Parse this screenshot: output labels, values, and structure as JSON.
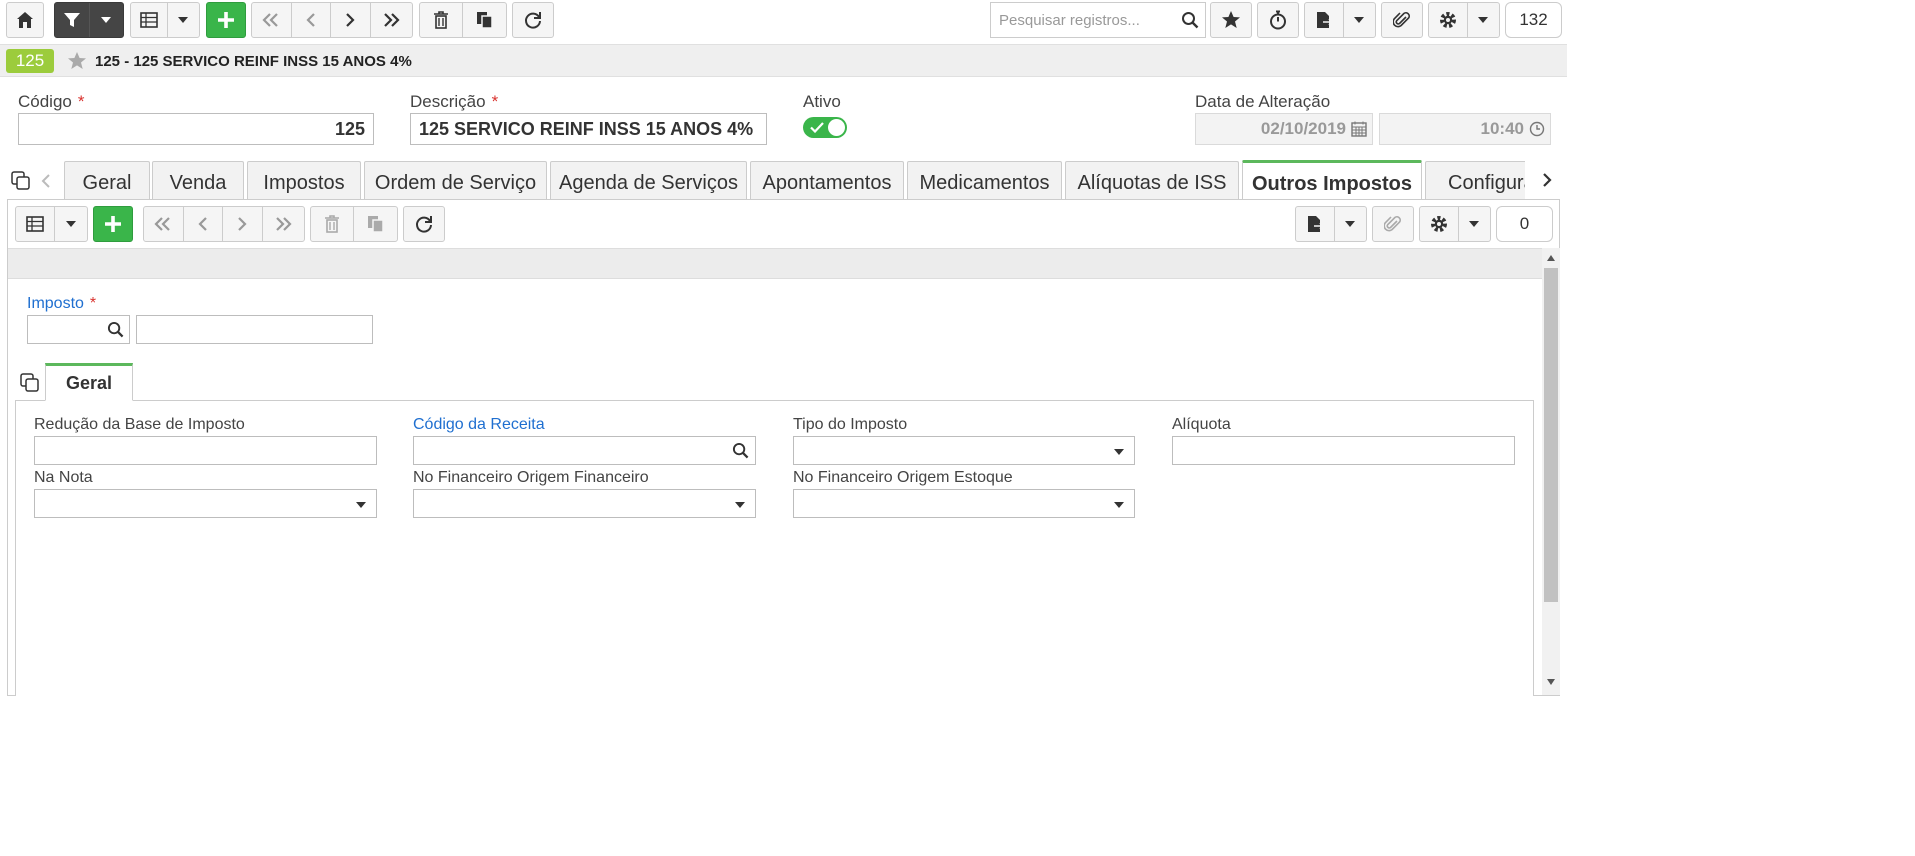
{
  "toolbar": {
    "search_placeholder": "Pesquisar registros...",
    "record_count": "132"
  },
  "record": {
    "badge": "125",
    "title": "125 - 125 SERVICO REINF INSS 15 ANOS 4%"
  },
  "header_form": {
    "codigo_label": "Código",
    "codigo_value": "125",
    "descricao_label": "Descrição",
    "descricao_value": "125 SERVICO REINF INSS 15 ANOS 4%",
    "ativo_label": "Ativo",
    "data_label": "Data de Alteração",
    "data_value": "02/10/2019",
    "hora_value": "10:40",
    "required_mark": "*"
  },
  "tabs": [
    {
      "label": "Geral"
    },
    {
      "label": "Venda"
    },
    {
      "label": "Impostos"
    },
    {
      "label": "Ordem de Serviço"
    },
    {
      "label": "Agenda de Serviços"
    },
    {
      "label": "Apontamentos"
    },
    {
      "label": "Medicamentos"
    },
    {
      "label": "Alíquotas de ISS"
    },
    {
      "label": "Outros Impostos"
    },
    {
      "label": "Configurações"
    }
  ],
  "subtoolbar": {
    "record_count": "0"
  },
  "detail": {
    "imposto_label": "Imposto",
    "subtab_label": "Geral",
    "reducao_label": "Redução da Base de Imposto",
    "codigo_receita_label": "Código da Receita",
    "tipo_imposto_label": "Tipo do Imposto",
    "aliquota_label": "Alíquota",
    "na_nota_label": "Na Nota",
    "fin_origem_fin_label": "No Financeiro Origem Financeiro",
    "fin_origem_est_label": "No Financeiro Origem Estoque"
  },
  "colors": {
    "accent_green": "#3ab54a",
    "tab_active_border": "#5cb85c",
    "badge_green": "#9ccc3c",
    "link_blue": "#1f6fd0",
    "required_red": "#d9322e"
  }
}
